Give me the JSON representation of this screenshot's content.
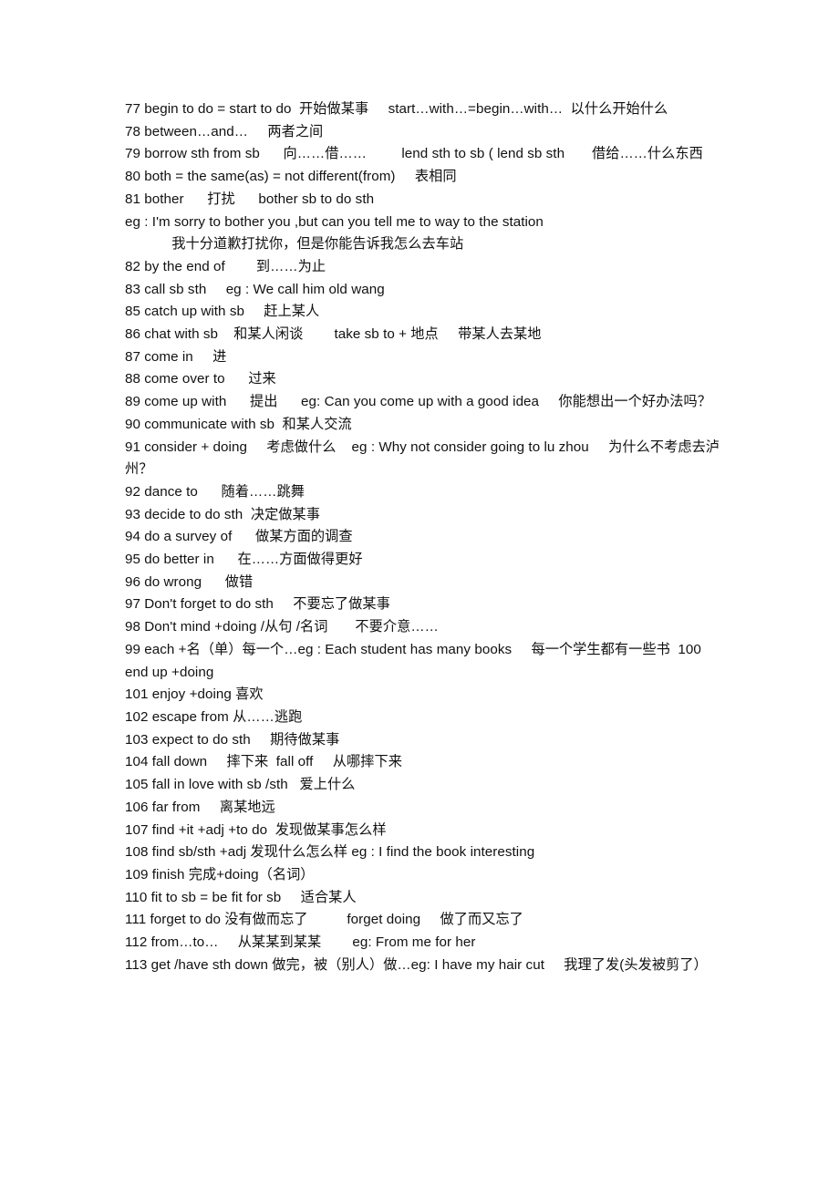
{
  "document": {
    "type": "study-notes",
    "language": "zh-en",
    "page_background": "#ffffff",
    "text_color": "#111111",
    "lines": [
      {
        "id": "line-77",
        "text": "77 begin to do = start to do  开始做某事     start…with…=begin…with…  以什么开始什么"
      },
      {
        "id": "line-78",
        "text": "78 between…and…     两者之间"
      },
      {
        "id": "line-79",
        "text": "79 borrow sth from sb      向……借……         lend sth to sb ( lend sb sth       借给……什么东西"
      },
      {
        "id": "line-80",
        "text": "80 both = the same(as) = not different(from)     表相同"
      },
      {
        "id": "line-81",
        "text": "81 bother      打扰      bother sb to do sth"
      },
      {
        "id": "line-81-eg",
        "text": "eg : I'm sorry to bother you ,but can you tell me to way to the station"
      },
      {
        "id": "line-81-cn",
        "text": "            我十分道歉打扰你，但是你能告诉我怎么去车站"
      },
      {
        "id": "line-82",
        "text": "82 by the end of        到……为止"
      },
      {
        "id": "line-83",
        "text": "83 call sb sth     eg : We call him old wang"
      },
      {
        "id": "line-85",
        "text": "85 catch up with sb     赶上某人"
      },
      {
        "id": "line-86",
        "text": "86 chat with sb    和某人闲谈        take sb to + 地点     带某人去某地"
      },
      {
        "id": "line-87",
        "text": "87 come in     进"
      },
      {
        "id": "line-88",
        "text": "88 come over to      过来"
      },
      {
        "id": "line-89",
        "text": "89 come up with      提出      eg: Can you come up with a good idea     你能想出一个好办法吗？"
      },
      {
        "id": "line-90",
        "text": "90 communicate with sb  和某人交流"
      },
      {
        "id": "line-91",
        "text": "91 consider + doing     考虑做什么    eg : Why not consider going to lu zhou     为什么不考虑去泸州？"
      },
      {
        "id": "line-92",
        "text": "92 dance to      随着……跳舞"
      },
      {
        "id": "line-93",
        "text": "93 decide to do sth  决定做某事"
      },
      {
        "id": "line-94",
        "text": "94 do a survey of      做某方面的调查"
      },
      {
        "id": "line-95",
        "text": "95 do better in      在……方面做得更好"
      },
      {
        "id": "line-96",
        "text": "96 do wrong      做错"
      },
      {
        "id": "line-97",
        "text": "97 Don't forget to do sth     不要忘了做某事"
      },
      {
        "id": "line-98",
        "text": "98 Don't mind +doing /从句 /名词       不要介意……"
      },
      {
        "id": "line-99",
        "text": "99 each +名（单）每一个…eg : Each student has many books     每一个学生都有一些书  100 end up +doing"
      },
      {
        "id": "line-101",
        "text": "101 enjoy +doing 喜欢"
      },
      {
        "id": "line-102",
        "text": "102 escape from 从……逃跑"
      },
      {
        "id": "line-103",
        "text": "103 expect to do sth     期待做某事"
      },
      {
        "id": "line-104",
        "text": "104 fall down     摔下来  fall off     从哪摔下来"
      },
      {
        "id": "line-105",
        "text": "105 fall in love with sb /sth   爱上什么"
      },
      {
        "id": "line-106",
        "text": "106 far from     离某地远"
      },
      {
        "id": "line-107",
        "text": "107 find +it +adj +to do  发现做某事怎么样"
      },
      {
        "id": "line-108",
        "text": "108 find sb/sth +adj 发现什么怎么样 eg : I find the book interesting"
      },
      {
        "id": "line-109",
        "text": "109 finish 完成+doing（名词）"
      },
      {
        "id": "line-110",
        "text": "110 fit to sb = be fit for sb     适合某人"
      },
      {
        "id": "line-111",
        "text": "111 forget to do 没有做而忘了          forget doing     做了而又忘了"
      },
      {
        "id": "line-112",
        "text": "112 from…to…     从某某到某某        eg: From me for her"
      },
      {
        "id": "line-113",
        "text": "113 get /have sth down 做完，被（别人）做…eg: I have my hair cut     我理了发(头发被剪了）"
      }
    ]
  }
}
